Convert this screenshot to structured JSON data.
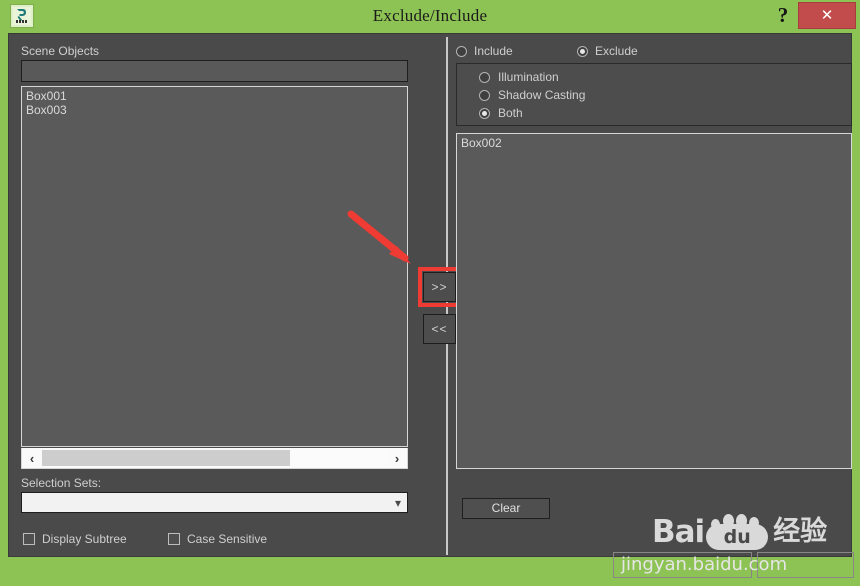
{
  "window": {
    "title": "Exclude/Include",
    "app_icon": "max-app-icon",
    "help_label": "?",
    "close_label": "✕",
    "titlebar_color": "#8dc254",
    "close_color": "#c24b4b",
    "body_color": "#4a4a4a"
  },
  "left_panel": {
    "scene_objects_label": "Scene Objects",
    "filter_value": "",
    "filter_placeholder": "",
    "objects": [
      "Box001",
      "Box003"
    ],
    "scrollbar": {
      "left_arrow": "‹",
      "right_arrow": "›",
      "thumb_percent": 72
    },
    "selection_sets_label": "Selection Sets:",
    "selection_sets_value": "",
    "selection_sets_options": [],
    "combo_arrow_icon": "chevron-down-icon",
    "checkboxes": [
      {
        "label": "Display Subtree",
        "checked": false
      },
      {
        "label": "Case Sensitive",
        "checked": false
      }
    ]
  },
  "transfer": {
    "include_button": ">>",
    "exclude_button": "<<",
    "highlight_color": "#ee3b33",
    "annotation": "red-arrow-pointing-to-include-button"
  },
  "right_panel": {
    "mode_radios": [
      {
        "label": "Include",
        "checked": false
      },
      {
        "label": "Exclude",
        "checked": true
      }
    ],
    "effect_radios": [
      {
        "label": "Illumination",
        "checked": false
      },
      {
        "label": "Shadow Casting",
        "checked": false
      },
      {
        "label": "Both",
        "checked": true
      }
    ],
    "excluded_objects": [
      "Box002"
    ],
    "clear_button": "Clear"
  },
  "watermark": {
    "brand": "Bai",
    "logo_text": "du",
    "suffix": "经验",
    "url": "jingyan.baidu.com"
  }
}
